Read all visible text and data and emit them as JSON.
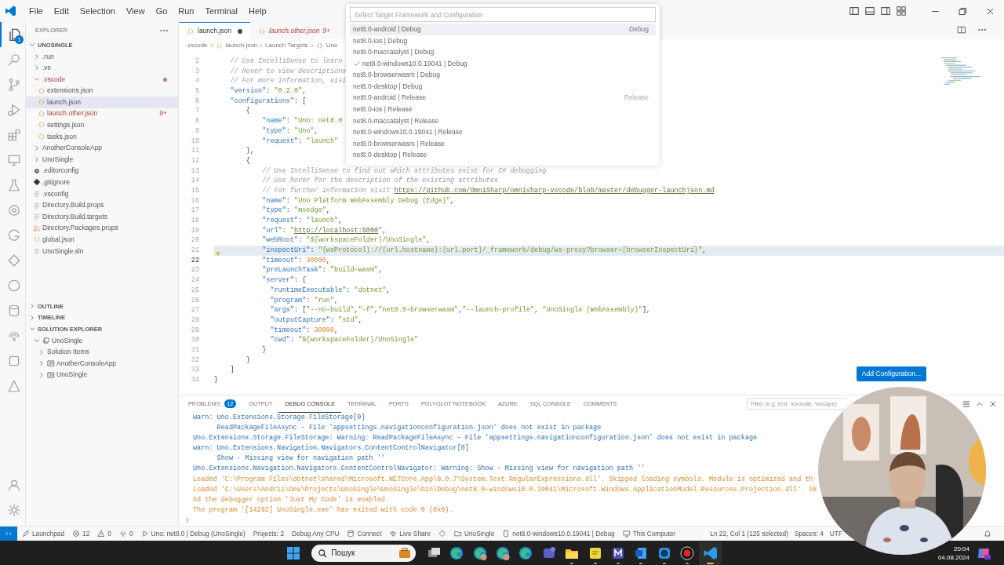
{
  "title_bar": {
    "menu": [
      "File",
      "Edit",
      "Selection",
      "View",
      "Go",
      "Run",
      "Terminal",
      "Help"
    ]
  },
  "activity_bar": {
    "items": [
      {
        "kind": "files",
        "selected": true,
        "badge": "1"
      },
      {
        "kind": "search",
        "selected": false
      },
      {
        "kind": "branch",
        "selected": false
      },
      {
        "kind": "debug",
        "selected": false
      },
      {
        "kind": "blocks",
        "selected": false
      },
      {
        "kind": "monitor",
        "selected": false
      },
      {
        "kind": "flask",
        "selected": false
      },
      {
        "kind": "ring",
        "selected": false
      },
      {
        "kind": "arc",
        "selected": false
      },
      {
        "kind": "diamond",
        "selected": false
      },
      {
        "kind": "circle",
        "selected": false
      },
      {
        "kind": "database",
        "selected": false
      },
      {
        "kind": "share",
        "selected": false
      },
      {
        "kind": "square",
        "selected": false
      },
      {
        "kind": "triangle",
        "selected": false
      }
    ]
  },
  "sidebar": {
    "title": "EXPLORER",
    "sections": [
      {
        "title": "UNOSINGLE",
        "expanded": true,
        "items": [
          {
            "label": ".run",
            "kind": "folder",
            "expanded": false,
            "selected": false,
            "error": false
          },
          {
            "label": ".vs",
            "kind": "folder",
            "expanded": false,
            "selected": false,
            "error": false
          },
          {
            "label": ".vscode",
            "kind": "folder",
            "expanded": true,
            "selected": false,
            "error": true,
            "children": [
              {
                "label": "extensions.json",
                "kind": "json",
                "selected": false,
                "error": false
              },
              {
                "label": "launch.json",
                "kind": "json",
                "selected": true,
                "error": false
              },
              {
                "label": "launch.other.json",
                "kind": "json",
                "selected": false,
                "error": true,
                "badge": "9+"
              },
              {
                "label": "settings.json",
                "kind": "json",
                "selected": false,
                "error": false
              },
              {
                "label": "tasks.json",
                "kind": "json",
                "selected": false,
                "error": false
              }
            ]
          },
          {
            "label": "AnotherConsoleApp",
            "kind": "folder",
            "expanded": false,
            "selected": false,
            "error": false
          },
          {
            "label": "UnoSingle",
            "kind": "folder",
            "expanded": false,
            "selected": false,
            "error": false
          },
          {
            "label": ".editorconfig",
            "kind": "gear",
            "selected": false,
            "error": false
          },
          {
            "label": ".gitignore",
            "kind": "git",
            "selected": false,
            "error": false
          },
          {
            "label": ".vsconfig",
            "kind": "lines",
            "selected": false,
            "error": false
          },
          {
            "label": "Directory.Build.props",
            "kind": "lines",
            "selected": false,
            "error": false
          },
          {
            "label": "Directory.Build.targets",
            "kind": "lines",
            "selected": false,
            "error": false
          },
          {
            "label": "Directory.Packages.props",
            "kind": "rss",
            "selected": false,
            "error": false
          },
          {
            "label": "global.json",
            "kind": "json",
            "selected": false,
            "error": false
          },
          {
            "label": "UnoSingle.sln",
            "kind": "lines",
            "selected": false,
            "error": false
          }
        ]
      },
      {
        "title": "OUTLINE",
        "expanded": false
      },
      {
        "title": "TIMELINE",
        "expanded": false
      },
      {
        "title": "SOLUTION EXPLORER",
        "expanded": true,
        "items": [
          {
            "label": "UnoSingle",
            "kind": "solution",
            "expanded": true,
            "selected": false,
            "error": false,
            "children": [
              {
                "label": "Solution Items",
                "kind": "plain",
                "expanded": false,
                "selected": false,
                "error": false
              },
              {
                "label": "AnotherConsoleApp",
                "kind": "project",
                "expanded": false,
                "selected": false,
                "error": false
              },
              {
                "label": "UnoSingle",
                "kind": "project",
                "expanded": false,
                "selected": false,
                "error": false
              }
            ]
          }
        ]
      }
    ]
  },
  "editor": {
    "tabs": [
      {
        "label": "launch.json",
        "selected": true,
        "modified": true,
        "preview": false,
        "error": false
      },
      {
        "label": "launch.other.json",
        "selected": false,
        "modified": false,
        "preview": true,
        "error": true,
        "badge": "9+"
      }
    ],
    "breadcrumbs": [
      {
        "label": ".vscode",
        "kind": "plain"
      },
      {
        "label": "launch.json",
        "kind": "json"
      },
      {
        "label": "Launch Targets",
        "kind": "plain"
      },
      {
        "label": "Uno",
        "kind": "braces"
      }
    ],
    "lines": [
      {
        "number": "2",
        "current": false,
        "selected": false,
        "tokens": [
          {
            "kind": "comment",
            "text": "    // Use IntelliSense to learn"
          }
        ]
      },
      {
        "number": "3",
        "current": false,
        "selected": false,
        "tokens": [
          {
            "kind": "comment",
            "text": "    // Hover to view descriptions"
          }
        ]
      },
      {
        "number": "4",
        "current": false,
        "selected": false,
        "tokens": [
          {
            "kind": "comment",
            "text": "    // For more information, visi"
          }
        ]
      },
      {
        "number": "5",
        "current": false,
        "selected": false,
        "tokens": [
          {
            "kind": "key",
            "text": "    \"version\""
          },
          {
            "kind": "punct",
            "text": ": "
          },
          {
            "kind": "string",
            "text": "\"0.2.0\""
          },
          {
            "kind": "punct",
            "text": ","
          }
        ]
      },
      {
        "number": "6",
        "current": false,
        "selected": false,
        "tokens": [
          {
            "kind": "key",
            "text": "    \"configurations\""
          },
          {
            "kind": "punct",
            "text": ": ["
          }
        ]
      },
      {
        "number": "7",
        "current": false,
        "selected": false,
        "tokens": [
          {
            "kind": "punct",
            "text": "        {"
          }
        ]
      },
      {
        "number": "8",
        "current": false,
        "selected": false,
        "tokens": [
          {
            "kind": "key",
            "text": "            \"name\""
          },
          {
            "kind": "punct",
            "text": ": "
          },
          {
            "kind": "string",
            "text": "\"Uno: net8.0"
          }
        ]
      },
      {
        "number": "9",
        "current": false,
        "selected": false,
        "tokens": [
          {
            "kind": "key",
            "text": "            \"type\""
          },
          {
            "kind": "punct",
            "text": ": "
          },
          {
            "kind": "string",
            "text": "\"Uno\""
          },
          {
            "kind": "punct",
            "text": ","
          }
        ]
      },
      {
        "number": "10",
        "current": false,
        "selected": false,
        "tokens": [
          {
            "kind": "key",
            "text": "            \"request\""
          },
          {
            "kind": "punct",
            "text": ": "
          },
          {
            "kind": "string",
            "text": "\"launch\""
          }
        ]
      },
      {
        "number": "11",
        "current": false,
        "selected": false,
        "tokens": [
          {
            "kind": "punct",
            "text": "        },"
          }
        ]
      },
      {
        "number": "12",
        "current": false,
        "selected": false,
        "tokens": [
          {
            "kind": "punct",
            "text": "        {"
          }
        ]
      },
      {
        "number": "13",
        "current": false,
        "selected": false,
        "tokens": [
          {
            "kind": "comment",
            "text": "            // Use IntelliSense to find out which attributes exist for C# debugging"
          }
        ]
      },
      {
        "number": "14",
        "current": false,
        "selected": false,
        "tokens": [
          {
            "kind": "comment",
            "text": "            // Use hover for the description of the existing attributes"
          }
        ]
      },
      {
        "number": "15",
        "current": false,
        "selected": false,
        "tokens": [
          {
            "kind": "comment",
            "text": "            // For further information visit "
          },
          {
            "kind": "link",
            "text": "https://github.com/OmniSharp/omnisharp-vscode/blob/master/debugger-launchjson.md"
          }
        ]
      },
      {
        "number": "16",
        "current": false,
        "selected": false,
        "tokens": [
          {
            "kind": "key",
            "text": "            \"name\""
          },
          {
            "kind": "punct",
            "text": ": "
          },
          {
            "kind": "string",
            "text": "\"Uno Platform WebAssembly Debug (Edge)\""
          },
          {
            "kind": "punct",
            "text": ","
          }
        ]
      },
      {
        "number": "17",
        "current": false,
        "selected": false,
        "tokens": [
          {
            "kind": "key",
            "text": "            \"type\""
          },
          {
            "kind": "punct",
            "text": ": "
          },
          {
            "kind": "string",
            "text": "\"msedge\""
          },
          {
            "kind": "punct",
            "text": ","
          }
        ]
      },
      {
        "number": "18",
        "current": false,
        "selected": false,
        "tokens": [
          {
            "kind": "key",
            "text": "            \"request\""
          },
          {
            "kind": "punct",
            "text": ": "
          },
          {
            "kind": "string",
            "text": "\"launch\""
          },
          {
            "kind": "punct",
            "text": ","
          }
        ]
      },
      {
        "number": "19",
        "current": false,
        "selected": false,
        "tokens": [
          {
            "kind": "key",
            "text": "            \"url\""
          },
          {
            "kind": "punct",
            "text": ": "
          },
          {
            "kind": "string",
            "text": "\""
          },
          {
            "kind": "link",
            "text": "http://localhost:5000"
          },
          {
            "kind": "string",
            "text": "\""
          },
          {
            "kind": "punct",
            "text": ","
          }
        ]
      },
      {
        "number": "20",
        "current": false,
        "selected": false,
        "tokens": [
          {
            "kind": "key",
            "text": "            \"webRoot\""
          },
          {
            "kind": "punct",
            "text": ": "
          },
          {
            "kind": "string",
            "text": "\"${workspaceFolder}/UnoSingle\""
          },
          {
            "kind": "punct",
            "text": ","
          }
        ]
      },
      {
        "number": "21",
        "current": false,
        "selected": true,
        "lightbulb": true,
        "tokens": [
          {
            "kind": "key",
            "text": "            \"inspectUri\""
          },
          {
            "kind": "punct",
            "text": ": "
          },
          {
            "kind": "string",
            "text": "\"{wsProtocol}://{url.hostname}:{url.port}/_framework/debug/ws-proxy?browser={browserInspectUri}\""
          },
          {
            "kind": "punct",
            "text": ","
          }
        ]
      },
      {
        "number": "22",
        "current": true,
        "selected": false,
        "tokens": [
          {
            "kind": "key",
            "text": "            \"timeout\""
          },
          {
            "kind": "punct",
            "text": ": "
          },
          {
            "kind": "number",
            "text": "30000"
          },
          {
            "kind": "punct",
            "text": ","
          }
        ]
      },
      {
        "number": "23",
        "current": false,
        "selected": false,
        "tokens": [
          {
            "kind": "key",
            "text": "            \"preLaunchTask\""
          },
          {
            "kind": "punct",
            "text": ": "
          },
          {
            "kind": "string",
            "text": "\"build-wasm\""
          },
          {
            "kind": "punct",
            "text": ","
          }
        ]
      },
      {
        "number": "24",
        "current": false,
        "selected": false,
        "tokens": [
          {
            "kind": "key",
            "text": "            \"server\""
          },
          {
            "kind": "punct",
            "text": ": {"
          }
        ]
      },
      {
        "number": "25",
        "current": false,
        "selected": false,
        "tokens": [
          {
            "kind": "key",
            "text": "              \"runtimeExecutable\""
          },
          {
            "kind": "punct",
            "text": ": "
          },
          {
            "kind": "string",
            "text": "\"dotnet\""
          },
          {
            "kind": "punct",
            "text": ","
          }
        ]
      },
      {
        "number": "26",
        "current": false,
        "selected": false,
        "tokens": [
          {
            "kind": "key",
            "text": "              \"program\""
          },
          {
            "kind": "punct",
            "text": ": "
          },
          {
            "kind": "string",
            "text": "\"run\""
          },
          {
            "kind": "punct",
            "text": ","
          }
        ]
      },
      {
        "number": "27",
        "current": false,
        "selected": false,
        "tokens": [
          {
            "kind": "key",
            "text": "              \"args\""
          },
          {
            "kind": "punct",
            "text": ": ["
          },
          {
            "kind": "string",
            "text": "\"--no-build\""
          },
          {
            "kind": "punct",
            "text": ","
          },
          {
            "kind": "string",
            "text": "\"-f\""
          },
          {
            "kind": "punct",
            "text": ","
          },
          {
            "kind": "string",
            "text": "\"net8.0-browserwasm\""
          },
          {
            "kind": "punct",
            "text": ","
          },
          {
            "kind": "string",
            "text": "\"--launch-profile\""
          },
          {
            "kind": "punct",
            "text": ", "
          },
          {
            "kind": "string",
            "text": "\"UnoSingle (WebAssembly)\""
          },
          {
            "kind": "punct",
            "text": "],"
          }
        ]
      },
      {
        "number": "28",
        "current": false,
        "selected": false,
        "tokens": [
          {
            "kind": "key",
            "text": "              \"outputCapture\""
          },
          {
            "kind": "punct",
            "text": ": "
          },
          {
            "kind": "string",
            "text": "\"std\""
          },
          {
            "kind": "punct",
            "text": ","
          }
        ]
      },
      {
        "number": "29",
        "current": false,
        "selected": false,
        "tokens": [
          {
            "kind": "key",
            "text": "              \"timeout\""
          },
          {
            "kind": "punct",
            "text": ": "
          },
          {
            "kind": "number",
            "text": "30000"
          },
          {
            "kind": "punct",
            "text": ","
          }
        ]
      },
      {
        "number": "30",
        "current": false,
        "selected": false,
        "tokens": [
          {
            "kind": "key",
            "text": "              \"cwd\""
          },
          {
            "kind": "punct",
            "text": ": "
          },
          {
            "kind": "string",
            "text": "\"${workspaceFolder}/UnoSingle\""
          }
        ]
      },
      {
        "number": "31",
        "current": false,
        "selected": false,
        "tokens": [
          {
            "kind": "punct",
            "text": "            }"
          }
        ]
      },
      {
        "number": "32",
        "current": false,
        "selected": false,
        "tokens": [
          {
            "kind": "punct",
            "text": "        }"
          }
        ]
      },
      {
        "number": "33",
        "current": false,
        "selected": false,
        "tokens": [
          {
            "kind": "punct",
            "text": "    ]"
          }
        ]
      },
      {
        "number": "34",
        "current": false,
        "selected": false,
        "tokens": [
          {
            "kind": "punct",
            "text": "}"
          }
        ]
      }
    ],
    "add_configuration_button": "Add Configuration..."
  },
  "quick_pick": {
    "placeholder": "Select Target Framework and Configuration",
    "items": [
      {
        "label": "net8.0-android | Debug",
        "selected": true,
        "checked": false,
        "description": "Debug"
      },
      {
        "label": "net8.0-ios | Debug",
        "selected": false,
        "checked": false
      },
      {
        "label": "net8.0-maccatalyst | Debug",
        "selected": false,
        "checked": false
      },
      {
        "label": "net8.0-windows10.0.19041 | Debug",
        "selected": false,
        "checked": true
      },
      {
        "label": "net8.0-browserwasm | Debug",
        "selected": false,
        "checked": false
      },
      {
        "label": "net8.0-desktop | Debug",
        "selected": false,
        "checked": false
      },
      {
        "label": "net8.0-android | Release",
        "selected": false,
        "checked": false,
        "description": "Release"
      },
      {
        "label": "net8.0-ios | Release",
        "selected": false,
        "checked": false
      },
      {
        "label": "net8.0-maccatalyst | Release",
        "selected": false,
        "checked": false
      },
      {
        "label": "net8.0-windows10.0.19041 | Release",
        "selected": false,
        "checked": false
      },
      {
        "label": "net8.0-browserwasm | Release",
        "selected": false,
        "checked": false
      },
      {
        "label": "net8.0-desktop | Release",
        "selected": false,
        "checked": false
      }
    ]
  },
  "panel": {
    "tabs": [
      {
        "label": "PROBLEMS",
        "selected": false,
        "badge": "12"
      },
      {
        "label": "OUTPUT",
        "selected": false
      },
      {
        "label": "DEBUG CONSOLE",
        "selected": true
      },
      {
        "label": "TERMINAL",
        "selected": false
      },
      {
        "label": "PORTS",
        "selected": false
      },
      {
        "label": "POLYGLOT NOTEBOOK",
        "selected": false
      },
      {
        "label": "AZURE",
        "selected": false
      },
      {
        "label": "SQL CONSOLE",
        "selected": false
      },
      {
        "label": "COMMENTS",
        "selected": false
      }
    ],
    "filter": {
      "placeholder": "Filter (e.g. text, !exclude, \\escape)"
    },
    "lines": [
      {
        "kind": "info",
        "text": "warn: Uno.Extensions.Storage.FileStorage[0]"
      },
      {
        "kind": "info",
        "text": "      ReadPackageFileAsync - File 'appsettings.navigationconfiguration.json' does not exist in package"
      },
      {
        "kind": "info",
        "text": "Uno.Extensions.Storage.FileStorage: Warning: ReadPackageFileAsync - File 'appsettings.navigationconfiguration.json' does not exist in package"
      },
      {
        "kind": "info",
        "text": "warn: Uno.Extensions.Navigation.Navigators.ContentControlNavigator[0]"
      },
      {
        "kind": "info",
        "text": "      Show - Missing view for navigation path ''"
      },
      {
        "kind": "info",
        "text": "Uno.Extensions.Navigation.Navigators.ContentControlNavigator: Warning: Show - Missing view for navigation path ''"
      },
      {
        "kind": "warning",
        "text": "Loaded 'C:\\Program Files\\dotnet\\shared\\Microsoft.NETCore.App\\8.0.7\\System.Text.RegularExpressions.dll'. Skipped loading symbols. Module is optimized and th"
      },
      {
        "kind": "warning",
        "text": "Loaded 'C:\\Users\\Andrii\\Dev\\Projects\\UnoSingle\\UnoSingle\\bin\\Debug\\net8.0-windows10.0.19041\\Microsoft.Windows.ApplicationModel.Resources.Projection.dll'. Sk"
      },
      {
        "kind": "warning",
        "text": "nd the debugger option 'Just My Code' is enabled."
      },
      {
        "kind": "warning",
        "text": "The program '[14292] UnoSingle.exe' has exited with code 0 (0x0)."
      }
    ]
  },
  "status_bar": {
    "left": [
      {
        "kind": "remote"
      },
      {
        "kind": "rocket",
        "text": "Launchpad"
      },
      {
        "kind": "error",
        "text": "12"
      },
      {
        "kind": "warning",
        "text": "0"
      },
      {
        "kind": "antenna",
        "text": "0"
      },
      {
        "kind": "play",
        "text": "Uno: net8.0 | Debug (UnoSingle)"
      },
      {
        "kind": "plain",
        "text": "Projects: 2"
      },
      {
        "kind": "plain",
        "text": "Debug Any CPU"
      },
      {
        "kind": "database",
        "text": "Connect"
      },
      {
        "kind": "share",
        "text": "Live Share"
      },
      {
        "kind": "diamond"
      },
      {
        "kind": "folder",
        "text": "UnoSingle"
      },
      {
        "kind": "device",
        "text": "net8.0-windows10.0.19041 | Debug"
      },
      {
        "kind": "monitor",
        "text": "This Computer"
      }
    ],
    "right": [
      "Ln 22, Col 1 (125 selected)",
      "Spaces: 4",
      "UTF"
    ]
  },
  "taskbar": {
    "search": {
      "placeholder": "Пошук"
    },
    "apps": [
      {
        "kind": "taskview",
        "running": false,
        "selected": false
      },
      {
        "kind": "swirl",
        "running": false,
        "selected": false
      },
      {
        "kind": "swirl-avatar",
        "running": false,
        "selected": false
      },
      {
        "kind": "swirl-avatar",
        "running": false,
        "selected": false
      },
      {
        "kind": "swirl",
        "running": false,
        "selected": false
      },
      {
        "kind": "tile",
        "running": false,
        "selected": false
      },
      {
        "kind": "folder",
        "running": true,
        "selected": false
      },
      {
        "kind": "note",
        "running": true,
        "selected": false
      },
      {
        "kind": "mtile",
        "running": true,
        "selected": false
      },
      {
        "kind": "document",
        "running": true,
        "selected": false
      },
      {
        "kind": "circle",
        "running": true,
        "selected": false
      },
      {
        "kind": "record",
        "running": true,
        "selected": false
      },
      {
        "kind": "ribbon",
        "running": true,
        "selected": true
      }
    ],
    "time": "20:04",
    "date": "04.08.2024"
  }
}
